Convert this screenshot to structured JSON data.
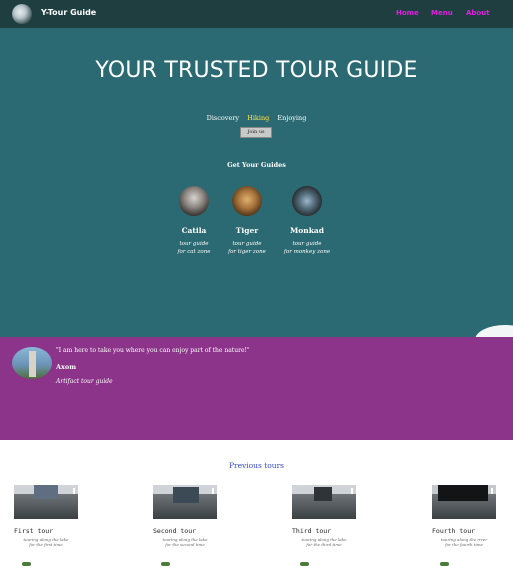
{
  "nav": {
    "brand": "Y-Tour Guide",
    "links": [
      "Home",
      "Menu",
      "About"
    ]
  },
  "hero": {
    "title": "YOUR TRUSTED TOUR GUIDE",
    "tagline": [
      "Discovery",
      "Hiking",
      "Enjoying"
    ],
    "join_button": "Join us",
    "guides_title": "Get Your Guides"
  },
  "guides": [
    {
      "name": "Catila",
      "desc1": "tour guide",
      "desc2": "for cat zone"
    },
    {
      "name": "Tiger",
      "desc1": "tour guide",
      "desc2": "for tiger zone"
    },
    {
      "name": "Monkad",
      "desc1": "tour guide",
      "desc2": "for monkey zone"
    }
  ],
  "testimonial": {
    "quote": "\"I am here to take you where you can enjoy part of the nature!\"",
    "name": "Axom",
    "role": "Artifact tour guide"
  },
  "previous": {
    "title": "Previous tours",
    "cards": [
      {
        "title": "First tour",
        "sub1": "touring along the lake",
        "sub2": "for the first time"
      },
      {
        "title": "Second tour",
        "sub1": "touring along the lake",
        "sub2": "for the second time"
      },
      {
        "title": "Third tour",
        "sub1": "touring along the lake",
        "sub2": "for the third time"
      },
      {
        "title": "Fourth tour",
        "sub1": "touring along the river",
        "sub2": "for the fourth time"
      }
    ]
  },
  "colors": {
    "nav_bg": "#1f3e40",
    "hero_bg": "#2b6a72",
    "nav_link": "#e21ee0",
    "testimonial_bg": "#8b3489",
    "previous_title": "#3548c9"
  }
}
